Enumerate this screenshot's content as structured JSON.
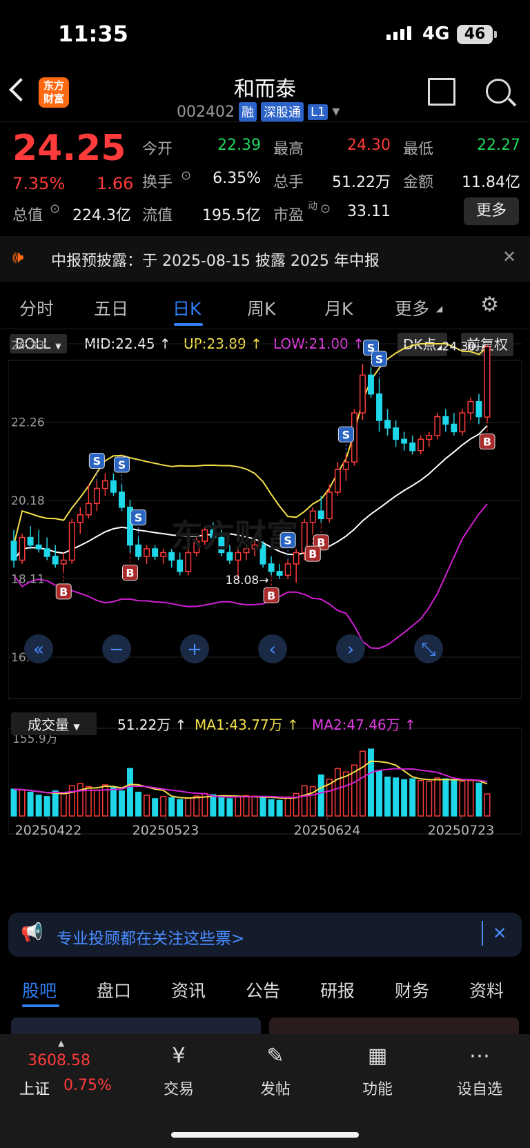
{
  "status_bar": {
    "time": "11:35",
    "network": "4G",
    "battery": "46"
  },
  "header": {
    "logo_line1": "东方",
    "logo_line2": "财富",
    "stock_name": "和而泰",
    "stock_code": "002402",
    "tags": [
      "融",
      "深股通",
      "L1"
    ]
  },
  "quote": {
    "price": "24.25",
    "change_pct": "7.35%",
    "change_abs": "1.66",
    "fields": {
      "open_label": "今开",
      "open": "22.39",
      "high_label": "最高",
      "high": "24.30",
      "low_label": "最低",
      "low": "22.27",
      "turnover_label": "换手",
      "turnover": "6.35%",
      "volume_label": "总手",
      "volume": "51.22万",
      "amount_label": "金额",
      "amount": "11.84亿",
      "mktcap_label": "总值",
      "mktcap": "224.3亿",
      "float_label": "流值",
      "float": "195.5亿",
      "pe_label": "市盈",
      "pe_sup": "动",
      "pe": "33.11"
    },
    "more_label": "更多"
  },
  "notice": {
    "text": "中报预披露：于 2025-08-15 披露 2025 年中报"
  },
  "chart_tabs": [
    "分时",
    "五日",
    "日K",
    "周K",
    "月K",
    "更多"
  ],
  "indicator": {
    "name": "BOLL",
    "mid": "MID:22.45",
    "up": "UP:23.89",
    "low": "LOW:21.00",
    "dk_label": "DK点",
    "adjust_label": "前复权",
    "y_ticks": [
      "24.33",
      "22.26",
      "20.18",
      "18.11",
      "16.03"
    ],
    "high_mark": "24.30",
    "low_mark": "18.08",
    "watermark": "东方财富"
  },
  "volume": {
    "name": "成交量",
    "value": "51.22万",
    "ma1": "MA1:43.77万",
    "ma2": "MA2:47.46万",
    "max_label": "155.9万",
    "dates": [
      "20250422",
      "20250523",
      "20250624",
      "20250723"
    ]
  },
  "promo": {
    "text": "专业投顾都在关注这些票>"
  },
  "bottom_tabs": [
    "股吧",
    "盘口",
    "资讯",
    "公告",
    "研报",
    "财务",
    "资料"
  ],
  "footer": {
    "index_value": "3608.58",
    "index_name": "上证",
    "index_change": "0.75%",
    "items": [
      "交易",
      "发帖",
      "功能",
      "设自选"
    ]
  },
  "colors": {
    "up": "#ff3b3b",
    "down": "#1ed7e8",
    "accent": "#2f7ef5",
    "mid": "#ffffff",
    "upper": "#f5e14a",
    "lower": "#d21fd6"
  },
  "chart_data": {
    "type": "candlestick",
    "y_range": [
      16.03,
      24.33
    ],
    "ohlc": [
      [
        19.1,
        19.4,
        18.4,
        18.6
      ],
      [
        18.6,
        19.3,
        18.5,
        19.2
      ],
      [
        19.2,
        19.5,
        18.9,
        19.0
      ],
      [
        19.0,
        19.4,
        18.8,
        18.9
      ],
      [
        18.9,
        19.2,
        18.6,
        18.7
      ],
      [
        18.7,
        19.0,
        18.4,
        18.5
      ],
      [
        18.5,
        18.8,
        18.3,
        18.6
      ],
      [
        18.6,
        19.7,
        18.5,
        19.6
      ],
      [
        19.6,
        20.0,
        19.3,
        19.8
      ],
      [
        19.8,
        20.6,
        19.7,
        20.1
      ],
      [
        20.1,
        20.7,
        19.9,
        20.5
      ],
      [
        20.5,
        20.9,
        20.3,
        20.7
      ],
      [
        20.7,
        20.9,
        20.3,
        20.4
      ],
      [
        20.4,
        20.6,
        19.9,
        20.0
      ],
      [
        20.0,
        20.2,
        18.8,
        19.0
      ],
      [
        19.0,
        19.2,
        18.6,
        18.7
      ],
      [
        18.7,
        19.0,
        18.5,
        18.9
      ],
      [
        18.9,
        19.0,
        18.6,
        18.7
      ],
      [
        18.7,
        18.9,
        18.5,
        18.8
      ],
      [
        18.8,
        18.9,
        18.4,
        18.6
      ],
      [
        18.6,
        18.8,
        18.2,
        18.3
      ],
      [
        18.3,
        18.9,
        18.2,
        18.8
      ],
      [
        18.8,
        19.2,
        18.7,
        19.1
      ],
      [
        19.1,
        19.5,
        19.0,
        19.4
      ],
      [
        19.4,
        19.6,
        19.1,
        19.2
      ],
      [
        19.2,
        19.4,
        18.7,
        18.8
      ],
      [
        18.8,
        19.0,
        18.5,
        18.6
      ],
      [
        18.6,
        18.9,
        18.1,
        18.8
      ],
      [
        18.8,
        19.0,
        18.6,
        18.9
      ],
      [
        18.9,
        19.2,
        18.7,
        19.0
      ],
      [
        19.0,
        19.1,
        18.4,
        18.5
      ],
      [
        18.5,
        18.7,
        18.2,
        18.3
      ],
      [
        18.3,
        18.5,
        18.1,
        18.2
      ],
      [
        18.2,
        18.6,
        18.1,
        18.5
      ],
      [
        18.5,
        18.9,
        18.0,
        18.8
      ],
      [
        18.8,
        19.7,
        18.6,
        19.6
      ],
      [
        19.6,
        20.0,
        19.3,
        19.9
      ],
      [
        19.9,
        20.3,
        19.6,
        19.7
      ],
      [
        19.7,
        20.6,
        19.6,
        20.4
      ],
      [
        20.4,
        21.2,
        20.3,
        21.0
      ],
      [
        21.0,
        21.4,
        20.7,
        21.2
      ],
      [
        21.2,
        22.6,
        21.1,
        22.5
      ],
      [
        22.5,
        23.8,
        22.3,
        23.5
      ],
      [
        23.5,
        23.7,
        22.9,
        23.0
      ],
      [
        23.0,
        23.4,
        22.0,
        22.3
      ],
      [
        22.3,
        22.6,
        21.9,
        22.1
      ],
      [
        22.1,
        22.3,
        21.6,
        21.8
      ],
      [
        21.8,
        22.0,
        21.5,
        21.7
      ],
      [
        21.7,
        21.9,
        21.4,
        21.5
      ],
      [
        21.5,
        21.9,
        21.4,
        21.8
      ],
      [
        21.8,
        22.0,
        21.6,
        21.9
      ],
      [
        21.9,
        22.5,
        21.8,
        22.4
      ],
      [
        22.4,
        22.6,
        22.0,
        22.2
      ],
      [
        22.2,
        22.5,
        21.9,
        22.0
      ],
      [
        22.0,
        22.6,
        21.9,
        22.5
      ],
      [
        22.5,
        22.9,
        22.3,
        22.8
      ],
      [
        22.8,
        23.0,
        22.2,
        22.4
      ],
      [
        22.39,
        24.3,
        22.27,
        24.25
      ]
    ],
    "volume": [
      62,
      60,
      55,
      48,
      45,
      58,
      52,
      70,
      75,
      68,
      60,
      72,
      66,
      58,
      110,
      55,
      48,
      40,
      45,
      42,
      38,
      42,
      46,
      52,
      49,
      45,
      40,
      44,
      47,
      46,
      42,
      38,
      36,
      44,
      52,
      70,
      68,
      95,
      85,
      110,
      102,
      118,
      150,
      155,
      105,
      90,
      88,
      84,
      86,
      82,
      80,
      88,
      86,
      84,
      80,
      82,
      76,
      51
    ]
  }
}
